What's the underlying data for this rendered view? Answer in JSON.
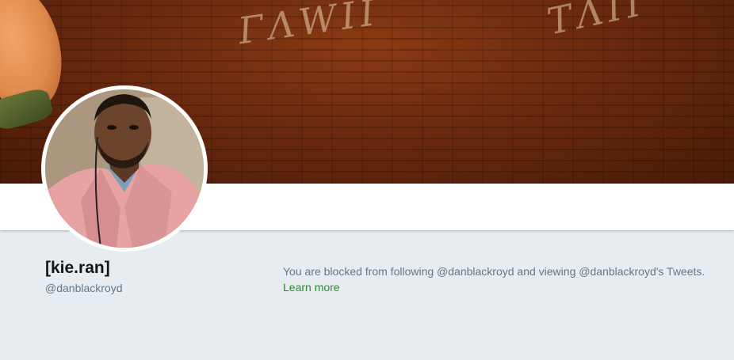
{
  "profile": {
    "display_name": "[kie.ran]",
    "screen_name": "@danblackroyd"
  },
  "blocked_notice": {
    "message": "You are blocked from following @danblackroyd and viewing @danblackroyd's Tweets.",
    "learn_more_label": "Learn more"
  },
  "colors": {
    "page_background": "#e6ecf0",
    "link_color": "#2f8a2f",
    "secondary_text": "#657786",
    "primary_text": "#14171a"
  },
  "icons": {
    "avatar": "profile-photo",
    "banner": "header-photo"
  }
}
